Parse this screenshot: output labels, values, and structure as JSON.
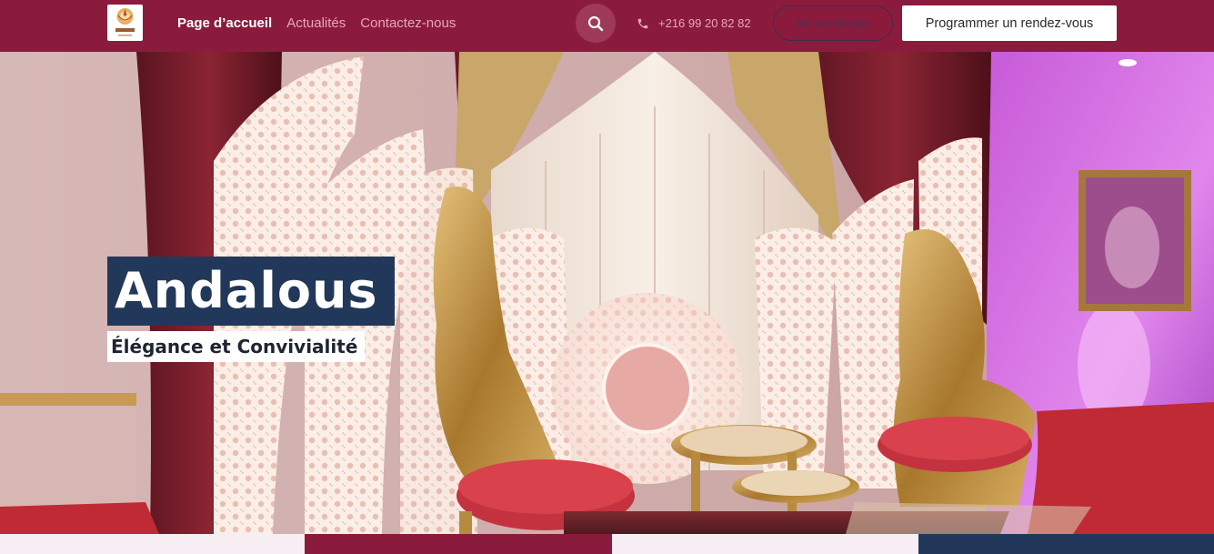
{
  "brand": {
    "logo_name": "PERLE"
  },
  "nav": {
    "items": [
      {
        "label": "Page d’accueil",
        "active": true
      },
      {
        "label": "Actualités",
        "active": false
      },
      {
        "label": "Contactez-nous",
        "active": false
      }
    ]
  },
  "header": {
    "search_icon": "search-icon",
    "phone_icon": "phone-icon",
    "phone": "+216 99 20 82 82",
    "login_label": "Se connecter",
    "appointment_label": "Programmer un rendez-vous"
  },
  "hero": {
    "title": "Andalous",
    "subtitle": "Élégance et Convivialité"
  },
  "colors": {
    "header_bg": "#8a1b3d",
    "title_bg": "#22385a",
    "strip": [
      "#f6eef2",
      "#8a1b3d",
      "#f6eef2",
      "#22385a"
    ]
  }
}
